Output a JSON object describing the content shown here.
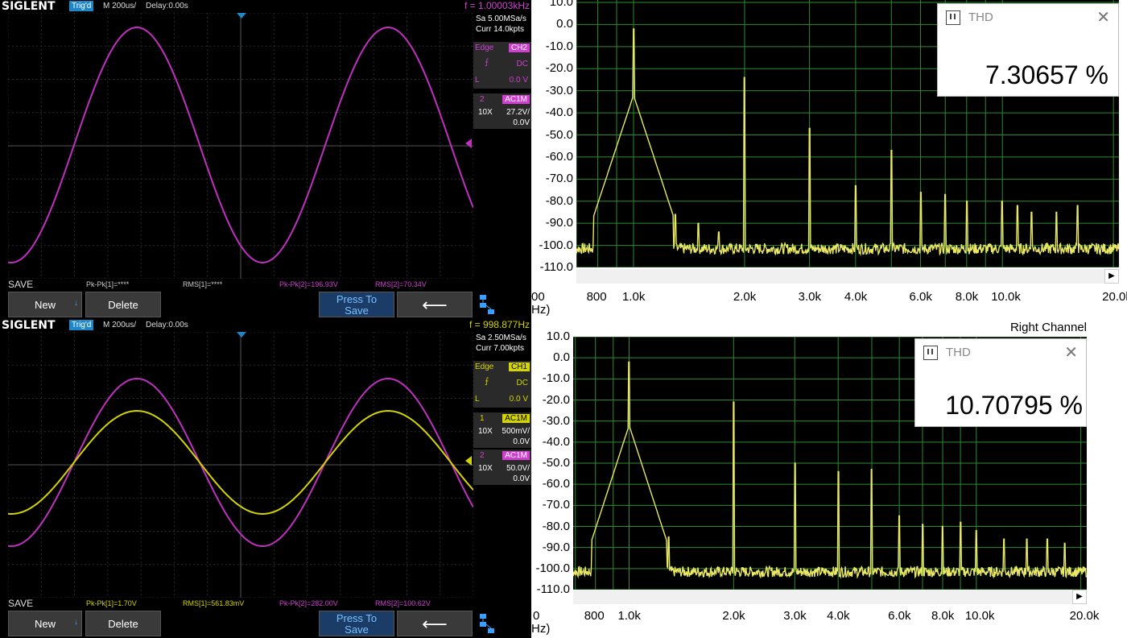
{
  "colors": {
    "ch1": "#d4d400",
    "ch2": "#c030c0",
    "trig": "#1f86c8",
    "fft_trace": "#e8e866",
    "fft_grid": "#2e8b2e"
  },
  "scope_top": {
    "logo": "SIGLENT",
    "trig_status": "Trig'd",
    "timebase": "M 200us/",
    "delay": "Delay:0.00s",
    "freq": "f = 1.00003kHz",
    "sample_rate": "Sa 5.00MSa/s",
    "curr": "Curr 14.0kpts",
    "trig_type": "Edge",
    "trig_src": "CH2",
    "coupling": "DC",
    "level_label": "L",
    "level": "0.0 V",
    "ch_boxes": [
      {
        "num": "2",
        "coupling": "AC1M",
        "probe": "10X",
        "scale": "27.2V/",
        "offset": "0.0V",
        "color": "magenta"
      }
    ],
    "save_label": "SAVE",
    "meas": [
      "Pk-Pk[1]=****",
      "RMS[1]=****",
      "Pk-Pk[2]=196.93V",
      "RMS[2]=70.34V"
    ],
    "buttons": {
      "new": "New",
      "delete": "Delete",
      "press1": "Press To",
      "press2": "Save"
    }
  },
  "scope_bottom": {
    "logo": "SIGLENT",
    "trig_status": "Trig'd",
    "timebase": "M 200us/",
    "delay": "Delay:0.00s",
    "freq": "f = 998.877Hz",
    "sample_rate": "Sa 2.50MSa/s",
    "curr": "Curr 7.00kpts",
    "trig_type": "Edge",
    "trig_src": "CH1",
    "coupling": "DC",
    "level_label": "L",
    "level": "0.0 V",
    "ch_boxes": [
      {
        "num": "1",
        "coupling": "AC1M",
        "probe": "10X",
        "scale": "500mV/",
        "offset": "0.0V",
        "color": "yellow"
      },
      {
        "num": "2",
        "coupling": "AC1M",
        "probe": "10X",
        "scale": "50.0V/",
        "offset": "0.0V",
        "color": "magenta"
      }
    ],
    "save_label": "SAVE",
    "meas": [
      "Pk-Pk[1]=1.70V",
      "RMS[1]=561.83mV",
      "Pk-Pk[2]=282.00V",
      "RMS[2]=100.62V"
    ],
    "buttons": {
      "new": "New",
      "delete": "Delete",
      "press1": "Press To",
      "press2": "Save"
    }
  },
  "fft_top": {
    "thd_title": "THD",
    "thd_value": "7.30657 %",
    "y_ticks": [
      "10.0",
      "0.0",
      "-10.0",
      "-20.0",
      "-30.0",
      "-40.0",
      "-50.0",
      "-60.0",
      "-70.0",
      "-80.0",
      "-90.0",
      "-100.0",
      "-110.0"
    ],
    "x_ticks": [
      "800",
      "1.0k",
      "2.0k",
      "3.0k",
      "4.0k",
      "6.0k",
      "8.0k",
      "10.0k",
      "20.0k"
    ],
    "x_left_partial": "00",
    "x_unit_partial": "Hz)"
  },
  "fft_bottom": {
    "channel_label": "Right Channel",
    "thd_title": "THD",
    "thd_value": "10.70795 %",
    "y_ticks": [
      "10.0",
      "0.0",
      "-10.0",
      "-20.0",
      "-30.0",
      "-40.0",
      "-50.0",
      "-60.0",
      "-70.0",
      "-80.0",
      "-90.0",
      "-100.0",
      "-110.0"
    ],
    "x_ticks": [
      "800",
      "1.0k",
      "2.0k",
      "3.0k",
      "4.0k",
      "6.0k",
      "8.0k",
      "10.0k",
      "20.0k"
    ],
    "x_left_partial": "0",
    "x_unit_partial": "Hz)"
  },
  "spectrum_peaks_top": [
    [
      1000,
      -2
    ],
    [
      2000,
      -24
    ],
    [
      3000,
      -47
    ],
    [
      5000,
      -57
    ],
    [
      4000,
      -73
    ],
    [
      6000,
      -76
    ],
    [
      7000,
      -77
    ],
    [
      8000,
      -80
    ],
    [
      10000,
      -80
    ],
    [
      11000,
      -82
    ],
    [
      12000,
      -85
    ],
    [
      16000,
      -82
    ],
    [
      14000,
      -85
    ],
    [
      1200,
      -77
    ],
    [
      800,
      -82
    ],
    [
      1300,
      -86
    ],
    [
      1500,
      -90
    ],
    [
      1700,
      -94
    ]
  ],
  "spectrum_peaks_bottom": [
    [
      1000,
      -2
    ],
    [
      2000,
      -21
    ],
    [
      3000,
      -50
    ],
    [
      4000,
      -54
    ],
    [
      5000,
      -53
    ],
    [
      6000,
      -75
    ],
    [
      7000,
      -79
    ],
    [
      8000,
      -80
    ],
    [
      9000,
      -78
    ],
    [
      10000,
      -82
    ],
    [
      12000,
      -86
    ],
    [
      14000,
      -86
    ],
    [
      16000,
      -86
    ],
    [
      18000,
      -88
    ],
    [
      900,
      -74
    ],
    [
      1200,
      -80
    ],
    [
      1300,
      -85
    ]
  ]
}
